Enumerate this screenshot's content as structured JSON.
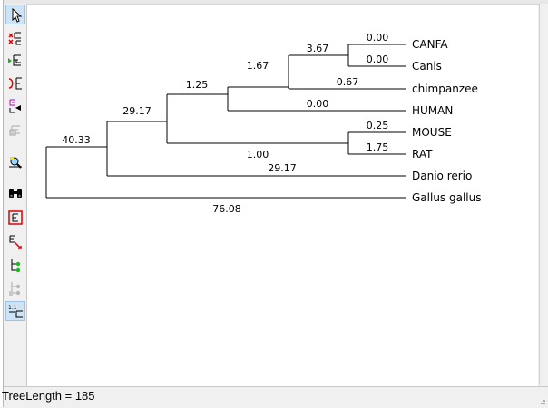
{
  "toolbar": {
    "buttons": [
      {
        "icon": "pointer-arrow-icon",
        "active": true
      },
      {
        "icon": "swap-subtrees-icon"
      },
      {
        "icon": "place-root-icon"
      },
      {
        "icon": "flip-subtree-icon"
      },
      {
        "icon": "compress-subtree-icon"
      },
      {
        "icon": "subtree-disabled-icon"
      },
      {
        "icon": "taxon-search-icon"
      },
      {
        "icon": "find-binoculars-icon"
      },
      {
        "icon": "resize-tree-icon"
      },
      {
        "icon": "edit-branch-icon"
      },
      {
        "icon": "branch-node-icon"
      },
      {
        "icon": "branch-node-disabled-icon"
      },
      {
        "icon": "branch-length-display-icon",
        "active": true
      }
    ]
  },
  "tree": {
    "taxa": [
      "CANFA",
      "Canis",
      "chimpanzee",
      "HUMAN",
      "MOUSE",
      "RAT",
      "Danio rerio",
      "Gallus gallus"
    ],
    "branch_labels": [
      "0.00",
      "0.00",
      "3.67",
      "0.67",
      "1.67",
      "0.00",
      "1.25",
      "0.25",
      "1.75",
      "1.00",
      "29.17",
      "29.17",
      "40.33",
      "76.08"
    ]
  },
  "status": {
    "text": "TreeLength = 185"
  }
}
